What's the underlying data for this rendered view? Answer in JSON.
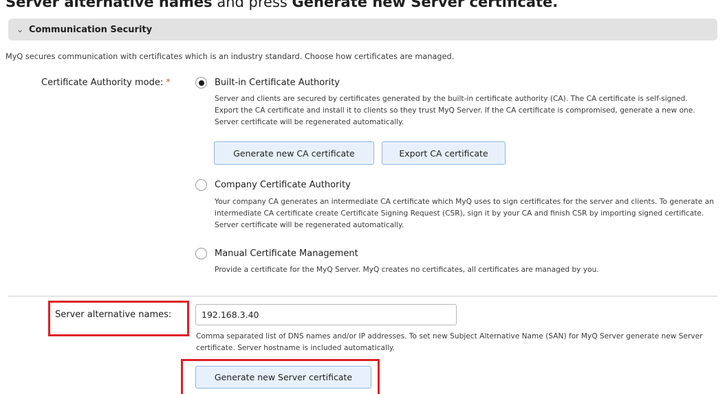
{
  "top_instruction": {
    "bold": "Server alternative names",
    "mid": " and press ",
    "bold2": "Generate new Server certificate."
  },
  "section": {
    "title": "Communication Security",
    "intro": "MyQ secures communication with certificates which is an industry standard. Choose how certificates are managed."
  },
  "ca_mode": {
    "label": "Certificate Authority mode:",
    "required_mark": "*",
    "options": [
      {
        "title": "Built-in Certificate Authority",
        "desc": "Server and clients are secured by certificates generated by the built-in certificate authority (CA). The CA certificate is self-signed. Export the CA certificate and install it to clients so they trust MyQ Server. If the CA certificate is compromised, generate a new one. Server certificate will be regenerated automatically.",
        "selected": true
      },
      {
        "title": "Company Certificate Authority",
        "desc": "Your company CA generates an intermediate CA certificate which MyQ uses to sign certificates for the server and clients. To generate an intermediate CA certificate create Certificate Signing Request (CSR), sign it by your CA and finish CSR by importing signed certificate. Server certificate will be regenerated automatically.",
        "selected": false
      },
      {
        "title": "Manual Certificate Management",
        "desc": "Provide a certificate for the MyQ Server. MyQ creates no certificates, all certificates are managed by you.",
        "selected": false
      }
    ],
    "buttons": {
      "generate_ca": "Generate new CA certificate",
      "export_ca": "Export CA certificate"
    }
  },
  "san": {
    "label": "Server alternative names:",
    "value": "192.168.3.40",
    "help": "Comma separated list of DNS names and/or IP addresses. To set new Subject Alternative Name (SAN) for MyQ Server generate new Server certificate. Server hostname is included automatically.",
    "button": "Generate new Server certificate"
  },
  "colors": {
    "highlight": "#e01e26",
    "button_bg": "#e8f1fb",
    "button_border": "#8eb5e3",
    "header_bg": "#e2e2e2"
  }
}
